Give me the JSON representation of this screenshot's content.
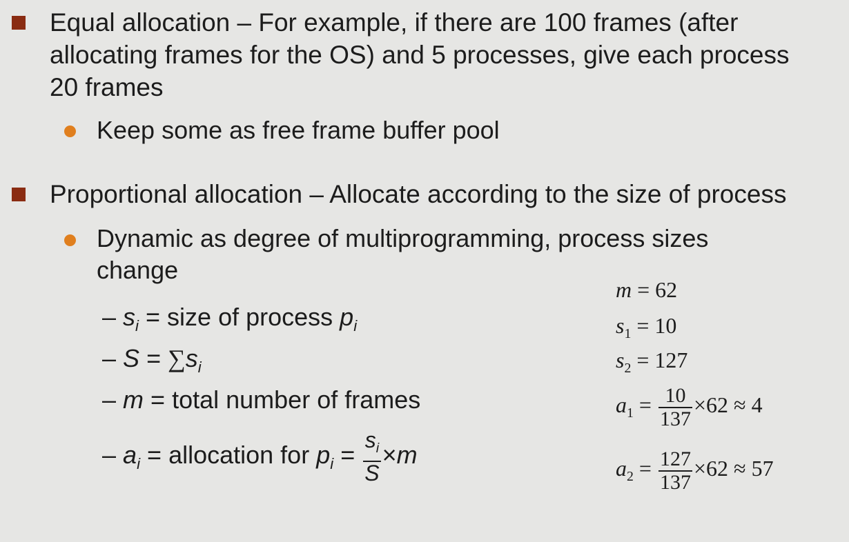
{
  "bullets": {
    "equal": {
      "text_line1": "Equal allocation – For example, if there are 100 frames (after",
      "text_line2": "allocating frames for the OS) and 5 processes, give each process",
      "text_line3": "20 frames",
      "sub": "Keep some as free frame buffer pool"
    },
    "proportional": {
      "text": "Proportional allocation – Allocate according to the size of process",
      "sub_line1": "Dynamic as degree of multiprogramming, process sizes",
      "sub_line2": "change",
      "defs": {
        "d1": {
          "dash": "–",
          "var": "s",
          "sub": "i",
          "eq": " = ",
          "text": "size of process ",
          "var2": "p",
          "sub2": "i"
        },
        "d2": {
          "dash": "–",
          "var": "S",
          "eq": " = ",
          "sum": "∑",
          "var2": "s",
          "sub2": "i"
        },
        "d3": {
          "dash": "–",
          "var": "m",
          "eq": " = ",
          "text": "total number of frames"
        },
        "d4": {
          "dash": "–",
          "var": "a",
          "sub": "i",
          "eq": " = ",
          "text": "allocation for ",
          "var2": "p",
          "sub2": "i",
          "eq2": " = ",
          "frac_num": "s",
          "frac_num_sub": "i",
          "frac_den": "S",
          "times": "×",
          "var3": "m"
        }
      }
    }
  },
  "example": {
    "m_line": {
      "var": "m",
      "eq": " = ",
      "val": "62"
    },
    "s1_line": {
      "var": "s",
      "sub": "1",
      "eq": " = ",
      "val": "10"
    },
    "s2_line": {
      "var": "s",
      "sub": "2",
      "eq": " = ",
      "val": "127"
    },
    "a1_line": {
      "var": "a",
      "sub": "1",
      "eq": " = ",
      "num": "10",
      "den": "137",
      "rest": "×62 ≈ 4"
    },
    "a2_line": {
      "var": "a",
      "sub": "2",
      "eq": " = ",
      "num": "127",
      "den": "137",
      "rest": "×62 ≈ 57"
    }
  }
}
